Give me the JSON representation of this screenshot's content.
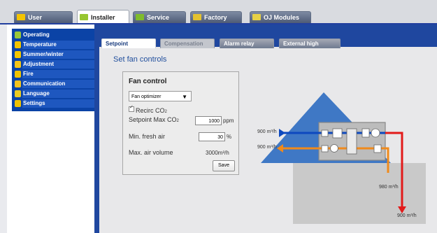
{
  "top_tabs": [
    {
      "label": "User",
      "icon": "user-icon"
    },
    {
      "label": "Installer",
      "icon": "installer-icon"
    },
    {
      "label": "Service",
      "icon": "service-icon"
    },
    {
      "label": "Factory",
      "icon": "factory-icon"
    },
    {
      "label": "OJ Modules",
      "icon": "modules-icon"
    }
  ],
  "sidebar": {
    "items": [
      {
        "label": "Operating",
        "icon": "operating-icon"
      },
      {
        "label": "Temperature",
        "icon": "temperature-icon"
      },
      {
        "label": "Summer/winter",
        "icon": "summer-winter-icon"
      },
      {
        "label": "Adjustment",
        "icon": "adjustment-icon"
      },
      {
        "label": "Fire",
        "icon": "fire-icon"
      },
      {
        "label": "Communication",
        "icon": "communication-icon"
      },
      {
        "label": "Language",
        "icon": "language-icon"
      },
      {
        "label": "Settings",
        "icon": "settings-icon"
      }
    ]
  },
  "sub_tabs": [
    {
      "label": "Setpoint"
    },
    {
      "label": "Compensation"
    },
    {
      "label": "Alarm relay"
    },
    {
      "label": "External high"
    }
  ],
  "page_title": "Set fan controls",
  "fan_control": {
    "title": "Fan control",
    "mode_selected": "Fan optimizer",
    "recirc_label": "Recirc CO",
    "recirc_sub": "2",
    "setpoint_label": "Setpoint Max CO",
    "setpoint_sub": "2",
    "setpoint_value": "1000",
    "setpoint_unit": "ppm",
    "min_fresh_label": "Min. fresh air",
    "min_fresh_value": "30",
    "min_fresh_unit": "%",
    "max_air_label": "Max. air volume",
    "max_air_value": "3000",
    "max_air_unit": "m³/h",
    "save_label": "Save"
  },
  "diagram": {
    "flow_top": "900 m³/h",
    "flow_middle": "900 m³/h",
    "flow_right": "980 m³/h",
    "flow_bottom": "900 m³/h"
  },
  "colors": {
    "brand_blue": "#0b43a6",
    "supply_red": "#e21a1a",
    "extract_orange": "#f08a1b",
    "roof_blue": "#3f78c5"
  }
}
